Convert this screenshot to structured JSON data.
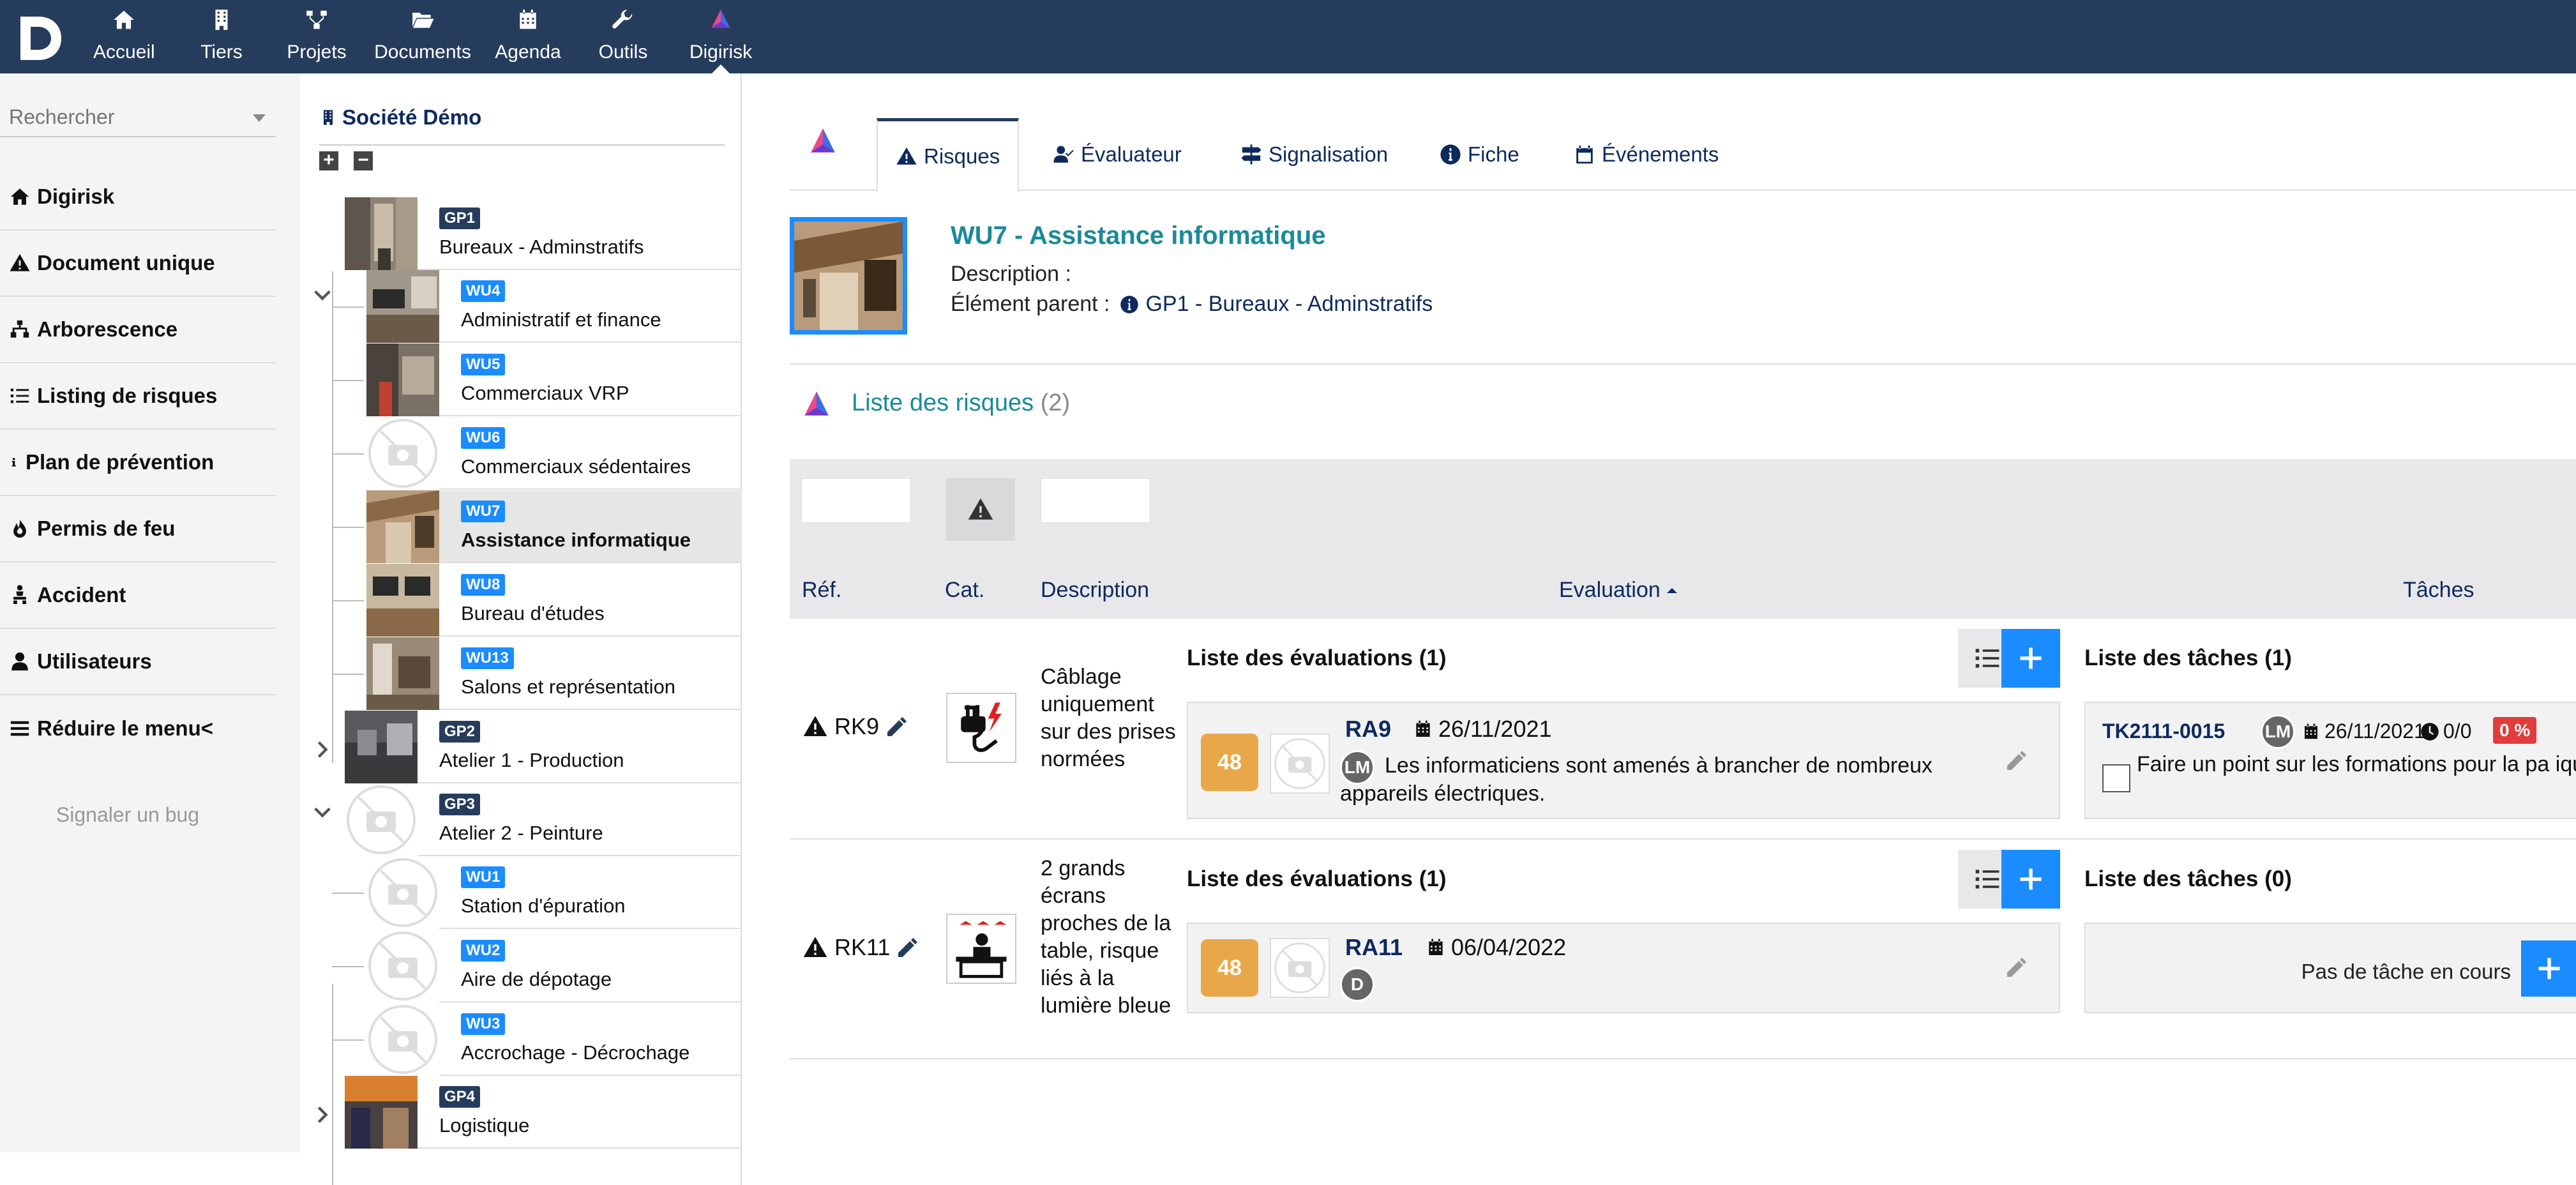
{
  "nav": {
    "logo_letter": "D",
    "items": [
      {
        "label": "Accueil",
        "icon": "home-icon"
      },
      {
        "label": "Tiers",
        "icon": "building-icon"
      },
      {
        "label": "Projets",
        "icon": "sitemap-icon"
      },
      {
        "label": "Documents",
        "icon": "folder-open-icon"
      },
      {
        "label": "Agenda",
        "icon": "calendar-icon"
      },
      {
        "label": "Outils",
        "icon": "wrench-icon"
      },
      {
        "label": "Digirisk",
        "icon": "digirisk-logo-icon"
      }
    ],
    "active": "Digirisk"
  },
  "sidebar": {
    "search_placeholder": "Rechercher",
    "items": [
      {
        "label": "Digirisk",
        "icon": "home-icon"
      },
      {
        "label": "Document unique",
        "icon": "warning-icon"
      },
      {
        "label": "Arborescence",
        "icon": "sitemap-icon"
      },
      {
        "label": "Listing de risques",
        "icon": "list-icon"
      },
      {
        "label": "Plan de prévention",
        "icon": "info-icon"
      },
      {
        "label": "Permis de feu",
        "icon": "fire-icon"
      },
      {
        "label": "Accident",
        "icon": "person-injured-icon"
      },
      {
        "label": "Utilisateurs",
        "icon": "user-icon"
      },
      {
        "label": "Réduire le menu<",
        "icon": "bars-icon"
      }
    ],
    "bug_link": "Signaler un bug"
  },
  "tree": {
    "title": "Société Démo",
    "nodes": [
      {
        "ref": "GP1",
        "label": "Bureaux - Adminstratifs",
        "level": 0,
        "expanded": true
      },
      {
        "ref": "WU4",
        "label": "Administratif et finance",
        "level": 1
      },
      {
        "ref": "WU5",
        "label": "Commerciaux VRP",
        "level": 1
      },
      {
        "ref": "WU6",
        "label": "Commerciaux sédentaires",
        "level": 1
      },
      {
        "ref": "WU7",
        "label": "Assistance informatique",
        "level": 1,
        "selected": true
      },
      {
        "ref": "WU8",
        "label": "Bureau d'études",
        "level": 1
      },
      {
        "ref": "WU13",
        "label": "Salons et représentation",
        "level": 1
      },
      {
        "ref": "GP2",
        "label": "Atelier 1 - Production",
        "level": 0,
        "expanded": false
      },
      {
        "ref": "GP3",
        "label": "Atelier 2 - Peinture",
        "level": 0,
        "expanded": true
      },
      {
        "ref": "WU1",
        "label": "Station d'épuration",
        "level": 1
      },
      {
        "ref": "WU2",
        "label": "Aire de dépotage",
        "level": 1
      },
      {
        "ref": "WU3",
        "label": "Accrochage - Décrochage",
        "level": 1
      },
      {
        "ref": "GP4",
        "label": "Logistique",
        "level": 0,
        "expanded": false
      }
    ]
  },
  "tabs": [
    {
      "label": "Risques",
      "icon": "warning-icon",
      "active": true
    },
    {
      "label": "Évaluateur",
      "icon": "user-check-icon"
    },
    {
      "label": "Signalisation",
      "icon": "signs-icon"
    },
    {
      "label": "Fiche",
      "icon": "info-icon"
    },
    {
      "label": "Événements",
      "icon": "calendar-icon"
    }
  ],
  "workunit": {
    "title": "WU7 - Assistance informatique",
    "description_label": "Description :",
    "parent_label": "Élément parent :",
    "parent_value": "GP1 - Bureaux - Adminstratifs"
  },
  "risk_list": {
    "title": "Liste des risques",
    "count": "(2)",
    "columns": {
      "ref": "Réf.",
      "cat": "Cat.",
      "description": "Description",
      "evaluation": "Evaluation",
      "tasks": "Tâches"
    },
    "rows": [
      {
        "ref": "RK9",
        "description": "Câblage uniquement sur des prises normées",
        "eval_title": "Liste des évaluations (1)",
        "eval": {
          "score": "48",
          "ref": "RA9",
          "date": "26/11/2021",
          "avatar": "LM",
          "comment": "Les informaticiens sont amenés à brancher de nombreux appareils électriques."
        },
        "task_title": "Liste des tâches (1)",
        "task": {
          "ref": "TK2111-0015",
          "avatar": "LM",
          "date": "26/11/2021",
          "progress": "0/0",
          "percent": "0 %",
          "text": "Faire un point sur les formations pour la pa ique"
        }
      },
      {
        "ref": "RK11",
        "description": "2 grands écrans proches de la table, risque liés à la lumière bleue",
        "eval_title": "Liste des évaluations (1)",
        "eval": {
          "score": "48",
          "ref": "RA11",
          "date": "06/04/2022",
          "avatar": "D",
          "comment": ""
        },
        "task_title": "Liste des tâches (0)",
        "no_task": "Pas de tâche en cours"
      }
    ]
  },
  "colors": {
    "topbar": "#263c5c",
    "accent_blue": "#1a8cff",
    "teal_title": "#1a8a9a",
    "score": "#e8a84a",
    "percent_badge": "#e23d3d"
  }
}
